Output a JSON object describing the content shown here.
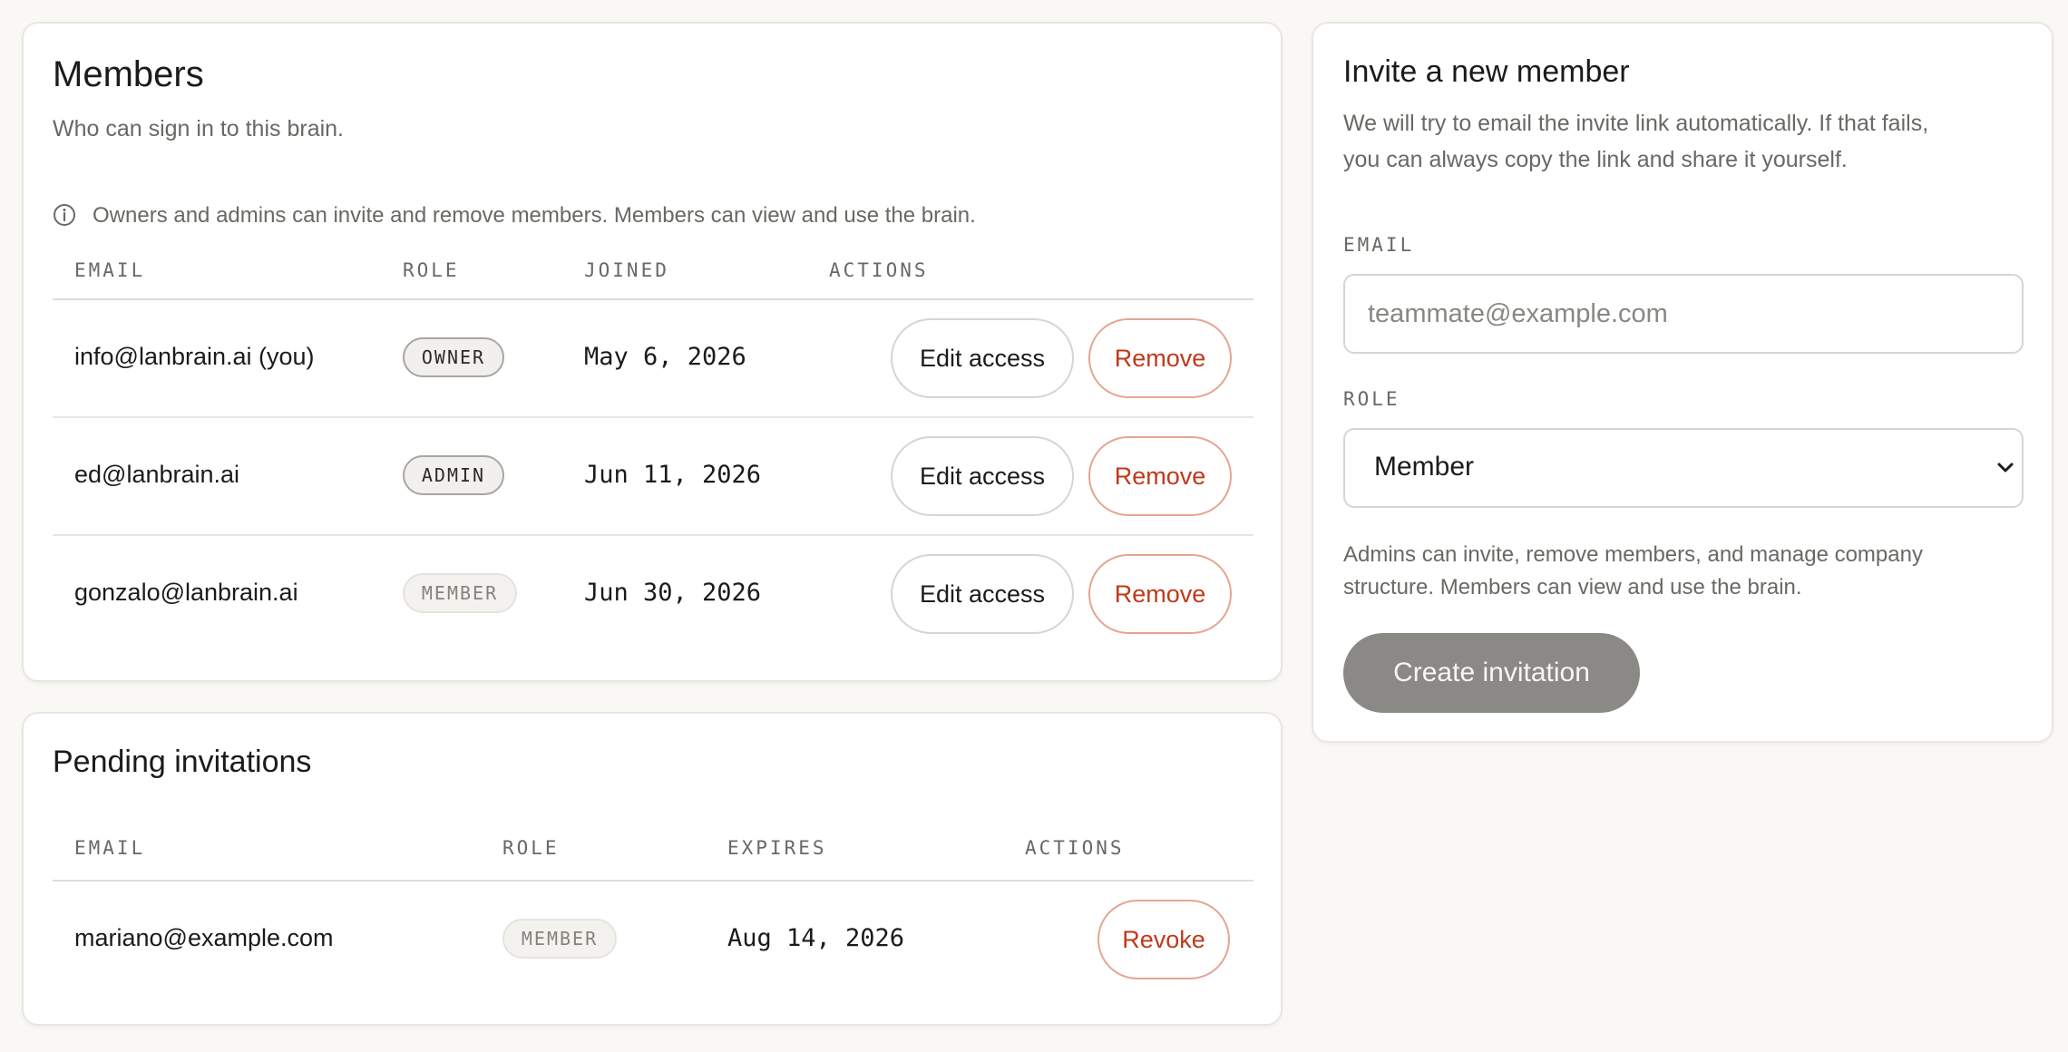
{
  "members": {
    "title": "Members",
    "subtitle": "Who can sign in to this brain.",
    "info": "Owners and admins can invite and remove members. Members can view and use the brain.",
    "columns": [
      "EMAIL",
      "ROLE",
      "JOINED",
      "ACTIONS"
    ],
    "rows": [
      {
        "email": "info@lanbrain.ai (you)",
        "role": "OWNER",
        "joined": "May 6, 2026",
        "edit_label": "Edit access",
        "remove_label": "Remove"
      },
      {
        "email": "ed@lanbrain.ai",
        "role": "ADMIN",
        "joined": "Jun 11, 2026",
        "edit_label": "Edit access",
        "remove_label": "Remove"
      },
      {
        "email": "gonzalo@lanbrain.ai",
        "role": "MEMBER",
        "joined": "Jun 30, 2026",
        "edit_label": "Edit access",
        "remove_label": "Remove"
      }
    ]
  },
  "pending": {
    "title": "Pending invitations",
    "columns": [
      "EMAIL",
      "ROLE",
      "EXPIRES",
      "ACTIONS"
    ],
    "rows": [
      {
        "email": "mariano@example.com",
        "role": "MEMBER",
        "expires": "Aug 14, 2026",
        "revoke_label": "Revoke"
      }
    ]
  },
  "invite": {
    "title": "Invite a new member",
    "description_line1": "We will try to email the invite link automatically. If that fails,",
    "description_line2": "you can always copy the link and share it yourself.",
    "email_label": "EMAIL",
    "email_placeholder": "teammate@example.com",
    "email_value": "",
    "role_label": "ROLE",
    "role_value": "Member",
    "help_line1": "Admins can invite, remove members, and manage company",
    "help_line2": "structure. Members can view and use the brain.",
    "submit_label": "Create invitation"
  },
  "icons": {
    "info": "info-circle-icon",
    "select": "chevron-down-icon"
  },
  "colors": {
    "background": "#f9f8f5",
    "danger": "#c0391b",
    "primary_disabled": "#8a8986"
  }
}
